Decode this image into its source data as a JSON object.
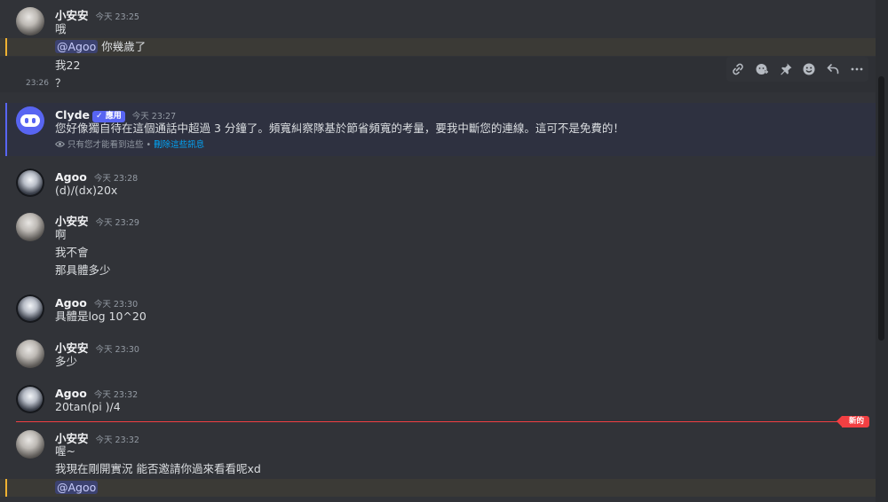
{
  "messages": {
    "g1": {
      "username": "小安安",
      "timestamp": "今天 23:25",
      "lines": [
        "哦",
        "你幾歲了",
        "我22",
        "？"
      ],
      "mention": "@Agoo",
      "hover_time": "23:26"
    },
    "clyde": {
      "username": "Clyde",
      "badge": "應用",
      "timestamp": "今天 23:27",
      "text": "您好像獨自待在這個通話中超過 3 分鐘了。頻寬糾察隊基於節省頻寬的考量，要我中斷您的連線。這可不是免費的！",
      "ephemeral_note": "只有您才能看到這些 • ",
      "dismiss_label": "刪除這些訊息"
    },
    "g2": {
      "username": "Agoo",
      "timestamp": "今天 23:28",
      "lines": [
        "(d)/(dx)20x"
      ]
    },
    "g3": {
      "username": "小安安",
      "timestamp": "今天 23:29",
      "lines": [
        "啊",
        "我不會",
        "那具體多少"
      ]
    },
    "g4": {
      "username": "Agoo",
      "timestamp": "今天 23:30",
      "lines": [
        "具體是log 10^20"
      ]
    },
    "g5": {
      "username": "小安安",
      "timestamp": "今天 23:30",
      "lines": [
        "多少"
      ]
    },
    "g6": {
      "username": "Agoo",
      "timestamp": "今天 23:32",
      "lines": [
        "20tan(pi )/4"
      ]
    },
    "g7": {
      "username": "小安安",
      "timestamp": "今天 23:32",
      "lines": [
        "喔~",
        "我現在剛開實況 能否邀請你過來看看呢xd"
      ],
      "mention": "@Agoo"
    }
  },
  "new_divider_label": "新的",
  "toolbar_icons": [
    "link-icon",
    "add-reaction-icon",
    "pin-icon",
    "emoji-icon",
    "reply-icon",
    "more-icon"
  ],
  "colors": {
    "background": "#313338",
    "mention_highlight": "#3b3a36",
    "mention_bar": "#f0b232",
    "accent": "#5865f2",
    "new_divider": "#f23f42",
    "link": "#00a8fc"
  }
}
